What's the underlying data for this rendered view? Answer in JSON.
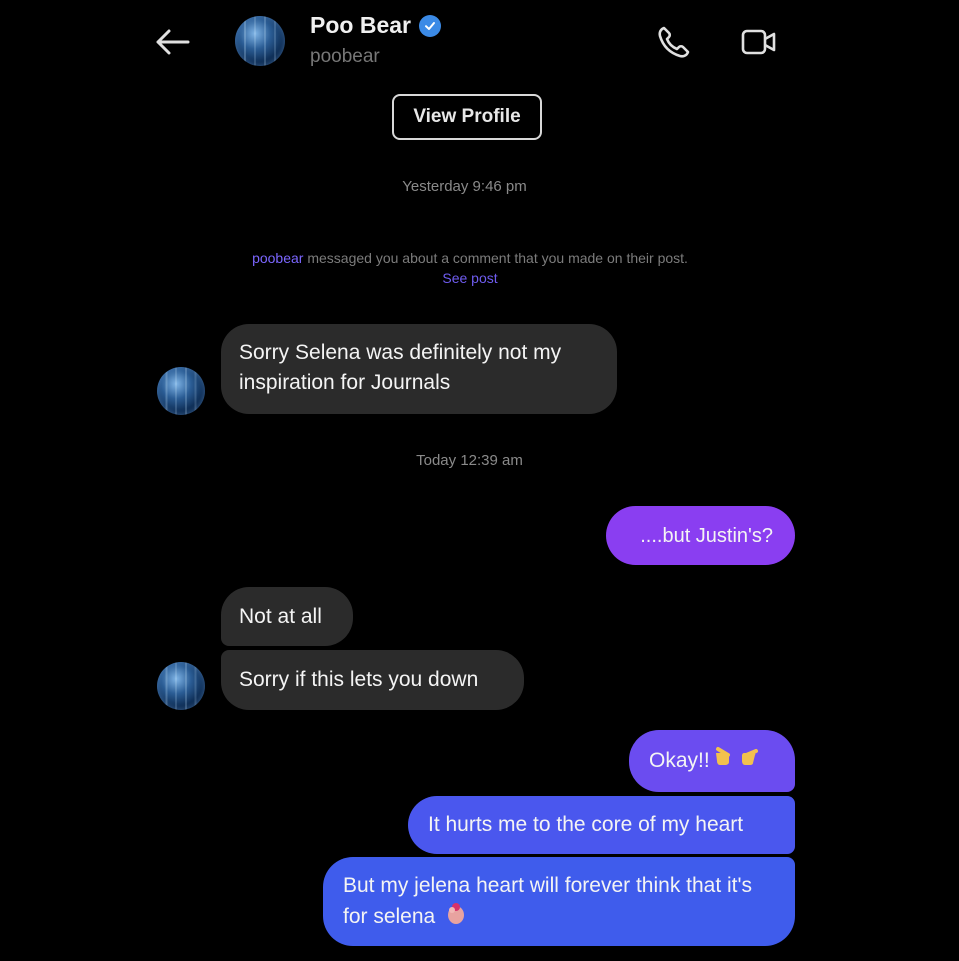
{
  "header": {
    "name": "Poo Bear",
    "username": "poobear",
    "view_profile_label": "View Profile"
  },
  "timestamps": {
    "first": "Yesterday 9:46 pm",
    "second": "Today 12:39 am"
  },
  "notice": {
    "username": "poobear",
    "text": " messaged you about a comment that you made on their post.",
    "link": "See post"
  },
  "messages": [
    {
      "from": "them",
      "text": "Sorry Selena was definitely not my inspiration for Journals"
    },
    {
      "from": "me",
      "text": "....but Justin's?"
    },
    {
      "from": "them",
      "text": "Not at all"
    },
    {
      "from": "them",
      "text": "Sorry if this lets you down"
    },
    {
      "from": "me",
      "text": "Okay!!"
    },
    {
      "from": "me",
      "text": "It hurts me to the core of my heart"
    },
    {
      "from": "me",
      "text": "But my jelena heart will forever think that it's for selena"
    }
  ],
  "colors": {
    "background": "#000000",
    "received_bubble": "#2b2b2b",
    "sent_purple": "#8a3ef1",
    "sent_blue": "#3f5cec",
    "verified": "#3b8ae6",
    "link": "#7b66ff"
  },
  "icons": {
    "back": "arrow-left-icon",
    "call": "phone-icon",
    "video": "video-camera-icon",
    "verified": "verified-badge-icon",
    "emoji_hands": "pointing-fingers-emoji",
    "emoji_pinch": "pinching-hand-emoji"
  }
}
